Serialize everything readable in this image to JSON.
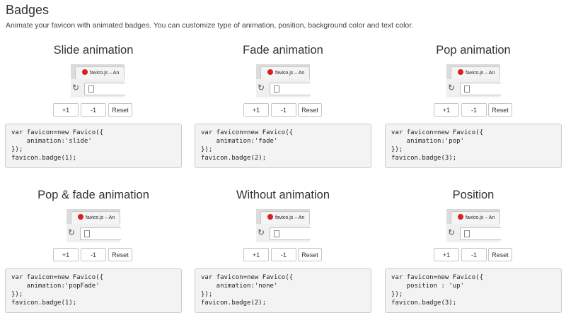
{
  "header": {
    "title": "Badges",
    "description": "Animate your favicon with animated badges. You can customize type of animation, position, background color and text color."
  },
  "browser_tab_title": "favico.js – An",
  "buttons": {
    "plus": "+1",
    "minus": "-1",
    "reset": "Reset"
  },
  "colors": {
    "favicon_badge": "#d82020",
    "code_background": "#f3f3f3"
  },
  "demos": [
    {
      "title": "Slide animation",
      "code": "var favicon=new Favico({\n    animation:'slide'\n});\nfavicon.badge(1);"
    },
    {
      "title": "Fade animation",
      "code": "var favicon=new Favico({\n    animation:'fade'\n});\nfavicon.badge(2);"
    },
    {
      "title": "Pop animation",
      "code": "var favicon=new Favico({\n    animation:'pop'\n});\nfavicon.badge(3);"
    },
    {
      "title": "Pop & fade animation",
      "code": "var favicon=new Favico({\n    animation:'popFade'\n});\nfavicon.badge(1);"
    },
    {
      "title": "Without animation",
      "code": "var favicon=new Favico({\n    animation:'none'\n});\nfavicon.badge(2);"
    },
    {
      "title": "Position",
      "code": "var favicon=new Favico({\n    position : 'up'\n});\nfavicon.badge(3);"
    }
  ]
}
